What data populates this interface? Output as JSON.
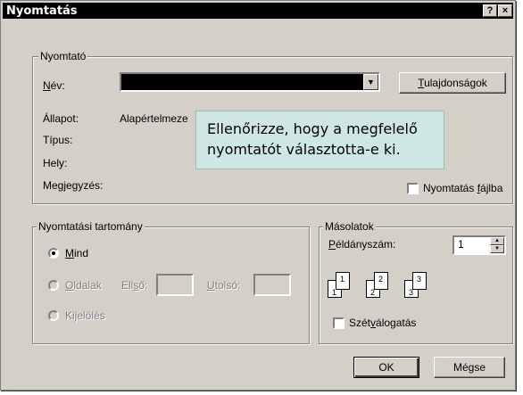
{
  "dialog": {
    "title": "Nyomtatás",
    "help_button": "?",
    "close_button": "×"
  },
  "printer": {
    "group_label": "Nyomtató",
    "name_label": "Név:",
    "name_value": "",
    "properties_button": "Tulajdonságok",
    "status_label": "Állapot:",
    "status_value": "Alapértelmeze",
    "type_label": "Típus:",
    "location_label": "Hely:",
    "comment_label": "Megjegyzés:",
    "print_to_file_label": "Nyomtatás fájlba",
    "print_to_file_checked": false
  },
  "range": {
    "group_label": "Nyomtatási tartomány",
    "all_label": "Mind",
    "pages_label": "Oldalak",
    "from_label": "Első:",
    "to_label": "Utolsó:",
    "selection_label": "Kijelölés",
    "selected": "all"
  },
  "copies": {
    "group_label": "Másolatok",
    "count_label": "Példányszám:",
    "count_value": "1",
    "collate_label": "Szétválogatás",
    "collate_checked": false,
    "collate_pages": [
      "1",
      "1",
      "2",
      "2",
      "3",
      "3"
    ]
  },
  "buttons": {
    "ok": "OK",
    "cancel": "Mégse"
  },
  "tooltip": {
    "line1": "Ellenőrizze, hogy a megfelelő",
    "line2": "nyomtatót választotta-e ki."
  }
}
